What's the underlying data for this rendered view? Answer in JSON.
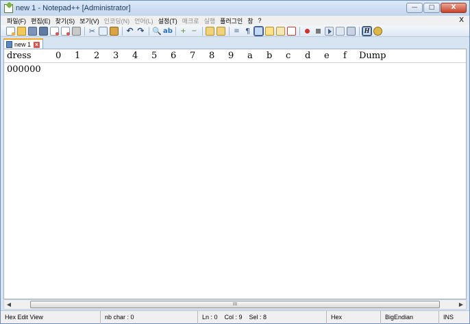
{
  "window": {
    "title": "new 1 - Notepad++ [Administrator]",
    "buttons": {
      "minimize": "—",
      "maximize": "□",
      "close": "X"
    }
  },
  "menubar": {
    "items": [
      {
        "label": "파일(F)",
        "enabled": true
      },
      {
        "label": "편집(E)",
        "enabled": true
      },
      {
        "label": "찾기(S)",
        "enabled": true
      },
      {
        "label": "보기(V)",
        "enabled": true
      },
      {
        "label": "인코딩(N)",
        "enabled": false
      },
      {
        "label": "언어(L)",
        "enabled": false
      },
      {
        "label": "설정(T)",
        "enabled": true
      },
      {
        "label": "매크로",
        "enabled": false
      },
      {
        "label": "실행",
        "enabled": false
      },
      {
        "label": "플러그인",
        "enabled": true
      },
      {
        "label": "창",
        "enabled": true
      },
      {
        "label": "?",
        "enabled": true
      }
    ],
    "close_label": "X"
  },
  "toolbar": {
    "icons": [
      "new-file-icon",
      "open-file-icon",
      "save-icon",
      "save-all-icon",
      "close-icon",
      "close-all-icon",
      "print-icon",
      "cut-icon",
      "copy-icon",
      "paste-icon",
      "undo-icon",
      "redo-icon",
      "find-icon",
      "replace-icon",
      "zoom-in-icon",
      "zoom-out-icon",
      "sync-vertical-icon",
      "sync-horizontal-icon",
      "word-wrap-icon",
      "show-all-chars-icon",
      "indent-guide-icon",
      "user-language-icon",
      "function-list-icon",
      "monitoring-icon",
      "record-macro-icon",
      "stop-macro-icon",
      "play-macro-icon",
      "play-macro-multiple-icon",
      "save-macro-icon",
      "hex-editor-icon",
      "plugin-icon"
    ],
    "cut_glyph": "✂",
    "undo_glyph": "↶",
    "redo_glyph": "↷",
    "find_glyph": "🔍",
    "replace_glyph": "ab",
    "zoom_in_glyph": "+",
    "zoom_out_glyph": "−",
    "wrap_glyph": "≡",
    "para_glyph": "¶",
    "hex_glyph": "H"
  },
  "tabs": [
    {
      "label": "new 1",
      "active": true
    }
  ],
  "hex_editor": {
    "header": {
      "address": "dress",
      "columns": [
        "0",
        "1",
        "2",
        "3",
        "4",
        "5",
        "6",
        "7",
        "8",
        "9",
        "a",
        "b",
        "c",
        "d",
        "e",
        "f"
      ],
      "dump": "Dump"
    },
    "rows": [
      {
        "address": "000000"
      }
    ]
  },
  "scrollbar": {
    "left_arrow": "◀",
    "right_arrow": "▶",
    "grip": "III"
  },
  "statusbar": {
    "mode": "Hex Edit View",
    "nb_char": "nb char : 0",
    "position": "Ln : 0    Col : 9    Sel : 8",
    "format": "Hex",
    "endian": "BigEndian",
    "insert_mode": "INS"
  },
  "colors": {
    "title_bg": "#c3d6ee",
    "tab_accent": "#f5a623",
    "menu_disabled": "#8c8c8c"
  }
}
